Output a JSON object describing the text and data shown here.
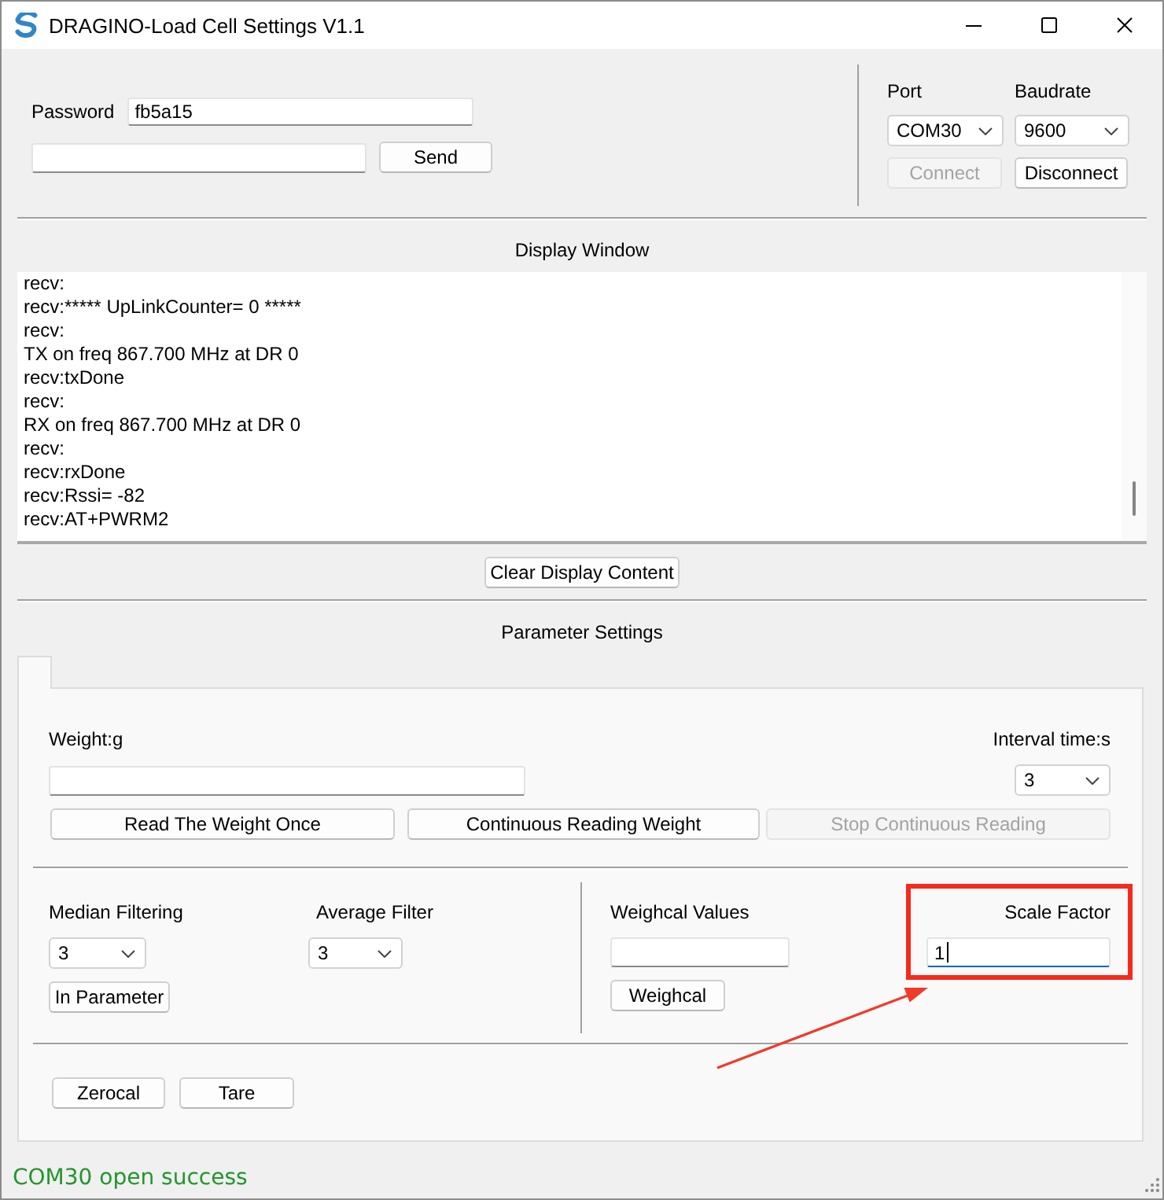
{
  "window": {
    "title": "DRAGINO-Load Cell Settings V1.1"
  },
  "connection": {
    "password_label": "Password",
    "password": "fb5a15",
    "send_button": "Send",
    "port": {
      "label": "Port",
      "value": "COM30"
    },
    "baudrate": {
      "label": "Baudrate",
      "value": "9600"
    },
    "buttons": [
      {
        "label": "Connect",
        "disabled": true
      },
      {
        "label": "Disconnect",
        "disabled": false
      }
    ]
  },
  "display_window": {
    "title": "Display Window",
    "lines": [
      "recv:",
      "recv:***** UpLinkCounter= 0 *****",
      "recv:",
      "TX on freq 867.700 MHz at DR 0",
      "recv:txDone",
      "recv:",
      "RX on freq 867.700 MHz at DR 0",
      "recv:",
      "recv:rxDone",
      "recv:Rssi= -82",
      "recv:AT+PWRM2"
    ],
    "clear_button": "Clear Display Content"
  },
  "parameter_settings": {
    "title": "Parameter Settings",
    "weight_label": "Weight:g",
    "interval": {
      "label": "Interval time:s",
      "value": "3"
    },
    "read_buttons": [
      {
        "label": "Read The Weight Once",
        "disabled": false
      },
      {
        "label": "Continuous Reading Weight",
        "disabled": false
      },
      {
        "label": "Stop Continuous Reading",
        "disabled": true
      }
    ],
    "median_filtering": {
      "label": "Median Filtering",
      "value": "3"
    },
    "average_filter": {
      "label": "Average Filter",
      "value": "3"
    },
    "in_parameter_button": "In Parameter",
    "weighcal_label": "Weighcal Values",
    "weighcal_button": "Weighcal",
    "scale_factor": {
      "label": "Scale Factor",
      "value": "1",
      "focused": true
    },
    "calibration_buttons": [
      {
        "label": "Zerocal"
      },
      {
        "label": "Tare"
      }
    ]
  },
  "status_bar": {
    "message": "COM30 open success"
  }
}
